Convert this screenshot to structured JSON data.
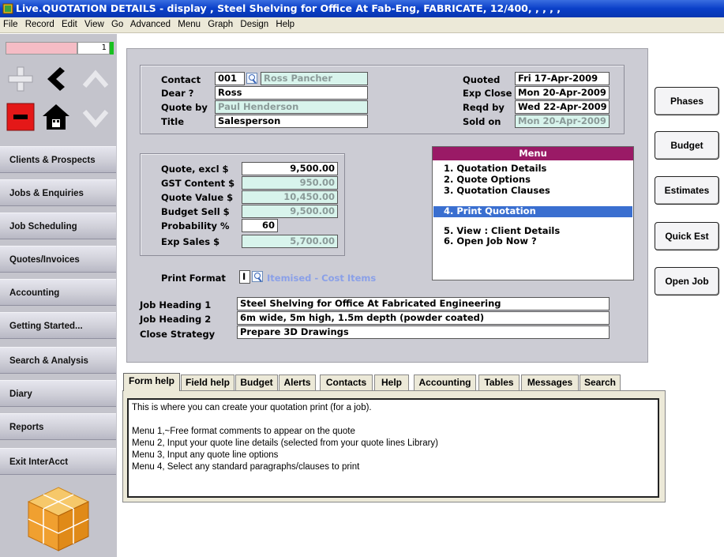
{
  "window": {
    "title": "Live.QUOTATION DETAILS - display , Steel Shelving for Office At Fab-Eng, FABRICATE, 12/400, , , , ,"
  },
  "menubar": [
    "File",
    "Record",
    "Edit",
    "View",
    "Go",
    "Advanced",
    "Menu",
    "Graph",
    "Design",
    "Help"
  ],
  "record": {
    "number": "1"
  },
  "nav": [
    "Clients & Prospects",
    "Jobs & Enquiries",
    "Job Scheduling",
    "Quotes/Invoices",
    "Accounting",
    "Getting Started...",
    "Search & Analysis",
    "Diary",
    "Reports",
    "Exit InterAcct"
  ],
  "contact": {
    "contact_label": "Contact",
    "contact_code": "001",
    "contact_name": "Ross Pancher",
    "dear_label": "Dear ?",
    "dear_value": "Ross",
    "quoteby_label": "Quote by",
    "quoteby_value": "Paul Henderson",
    "title_label": "Title",
    "title_value": "Salesperson"
  },
  "dates": {
    "quoted_label": "Quoted",
    "quoted_value": "Fri 17-Apr-2009",
    "expclose_label": "Exp Close",
    "expclose_value": "Mon 20-Apr-2009",
    "reqd_label": "Reqd by",
    "reqd_value": "Wed 22-Apr-2009",
    "sold_label": "Sold on",
    "sold_value": "Mon 20-Apr-2009"
  },
  "values": {
    "quote_excl_label": "Quote, excl $",
    "quote_excl_value": "9,500.00",
    "gst_label": "GST Content $",
    "gst_value": "950.00",
    "quote_value_label": "Quote Value $",
    "quote_value_value": "10,450.00",
    "budget_sell_label": "Budget Sell $",
    "budget_sell_value": "9,500.00",
    "probability_label": "Probability %",
    "probability_value": "60",
    "exp_sales_label": "Exp Sales  $",
    "exp_sales_value": "5,700.00"
  },
  "menu": {
    "header": "Menu",
    "items": [
      "1. Quotation Details",
      "2. Quote Options",
      "3. Quotation Clauses",
      "4. Print Quotation",
      "5. View : Client Details",
      "6. Open Job Now ?"
    ],
    "selected_index": 3
  },
  "print_format": {
    "label": "Print Format",
    "code": "I",
    "description": "Itemised - Cost Items"
  },
  "headings": {
    "h1_label": "Job Heading 1",
    "h1_value": "Steel Shelving for Office At Fabricated Engineering",
    "h2_label": "Job Heading 2",
    "h2_value": "6m wide, 5m high, 1.5m depth (powder coated)",
    "close_label": "Close Strategy",
    "close_value": "Prepare 3D Drawings"
  },
  "side_buttons": [
    "Phases",
    "Budget",
    "Estimates",
    "Quick Est",
    "Open Job"
  ],
  "tabs": [
    "Form help",
    "Field help",
    "Budget",
    "Alerts",
    "Contacts",
    "Help",
    "Accounting",
    "Tables",
    "Messages",
    "Search"
  ],
  "active_tab": "Form help",
  "help_lines": [
    "This is where you can create your quotation print  (for a job).",
    "",
    "Menu 1,~Free format comments to appear on the quote",
    "Menu 2,  Input your quote line details (selected from your quote lines Library)",
    "Menu 3, Input any quote line options",
    "Menu 4, Select any standard paragraphs/clauses to print"
  ],
  "colors": {
    "titlebar": "#0a3fc8",
    "menu_header": "#9a1a66",
    "menu_selected": "#3a6fd0",
    "readonly_field": "#d8f4ec",
    "panel": "#ccccd4"
  }
}
